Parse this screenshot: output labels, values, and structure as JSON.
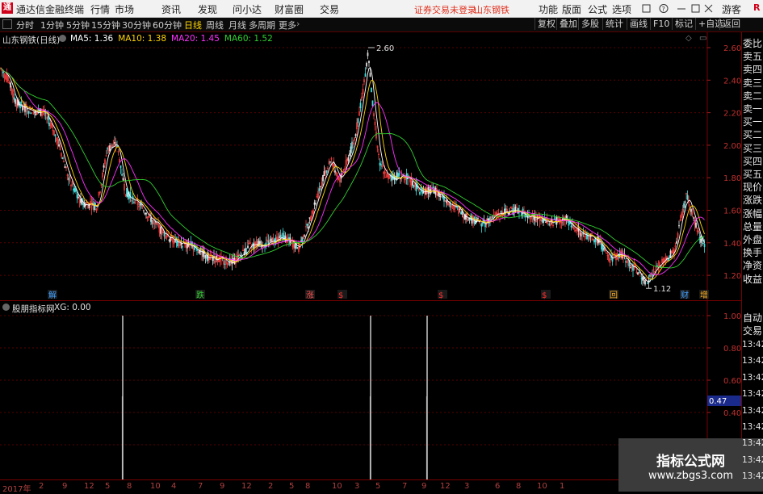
{
  "titlebar": {
    "logo": "通",
    "app_name": "通达信金融终端",
    "menus": [
      "行情",
      "市场",
      "资讯",
      "发现",
      "问小达",
      "财富圈",
      "交易"
    ],
    "warning": "证券交易未登录",
    "stock_name": "山东钢铁",
    "right_menus": [
      "功能",
      "版面",
      "公式",
      "选项"
    ],
    "guest": "游客",
    "badge": "R"
  },
  "toolbar": {
    "periods": [
      "分时",
      "1分钟",
      "5分钟",
      "15分钟",
      "30分钟",
      "60分钟",
      "日线",
      "周线",
      "月线",
      "多周期",
      "更多"
    ],
    "active_period": "日线",
    "buttons": [
      "复权",
      "叠加",
      "多股",
      "统计",
      "画线",
      "F10",
      "标记",
      "+自选",
      "返回"
    ]
  },
  "main_chart": {
    "title": "山东钢铁(日线)",
    "ma": [
      {
        "label": "MA5: 1.36",
        "color": "#ffffff"
      },
      {
        "label": "MA10: 1.38",
        "color": "#ffd400"
      },
      {
        "label": "MA20: 1.45",
        "color": "#ff30ff"
      },
      {
        "label": "MA60: 1.52",
        "color": "#30d030"
      }
    ],
    "y_ticks": [
      "2.60",
      "2.40",
      "2.20",
      "2.00",
      "1.80",
      "1.60",
      "1.40",
      "1.20"
    ],
    "high_label": "2.60",
    "low_label": "1.12",
    "markers": [
      {
        "text": "解",
        "color": "#40a0ff"
      },
      {
        "text": "跌",
        "color": "#30d030"
      },
      {
        "text": "涨",
        "color": "#ff5050"
      },
      {
        "text": "$",
        "color": "#ff3030"
      },
      {
        "text": "$",
        "color": "#ff3030"
      },
      {
        "text": "$",
        "color": "#ff3030"
      },
      {
        "text": "回",
        "color": "#ffb020"
      },
      {
        "text": "财",
        "color": "#40a0ff"
      },
      {
        "text": "增",
        "color": "#ffb020"
      }
    ]
  },
  "indicator": {
    "name": "股朋指标网",
    "xg": "XG: 0.00",
    "y_ticks": [
      "1.00",
      "0.80",
      "0.60",
      "0.40",
      "0.20"
    ],
    "current_value": "0.47"
  },
  "right_panel": {
    "labels": [
      "委比",
      "卖五",
      "卖四",
      "卖三",
      "卖二",
      "卖一",
      "买一",
      "买二",
      "买三",
      "买四",
      "买五",
      "现价",
      "涨跌",
      "涨幅",
      "总量",
      "外盘",
      "换手",
      "净资",
      "收益"
    ],
    "auto_trade_1": "自动",
    "auto_trade_2": "交易",
    "times": [
      "13:42",
      "13:42",
      "13:42",
      "13:42",
      "13:42",
      "13:42",
      "13:42",
      "13:42",
      "13:42"
    ]
  },
  "date_axis": [
    "2017年",
    "2",
    "9",
    "12",
    "5",
    "8",
    "10",
    "4",
    "7",
    "9",
    "12",
    "2",
    "5",
    "8",
    "10",
    "3",
    "5",
    "7",
    "9",
    "12",
    "3",
    "6",
    "8",
    "10",
    "1"
  ],
  "watermark": {
    "line1": "指标公式网",
    "line2": "www.zbgs3.com"
  }
}
